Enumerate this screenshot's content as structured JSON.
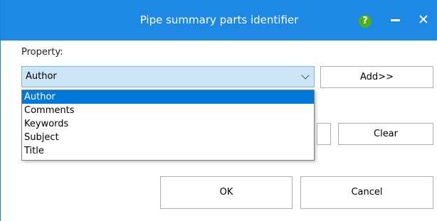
{
  "window": {
    "title": "Pipe summary parts identifier",
    "help_icon": "?",
    "close_icon": "✕"
  },
  "property": {
    "label": "Property:",
    "selected": "Author",
    "options": [
      "Author",
      "Comments",
      "Keywords",
      "Subject",
      "Title"
    ]
  },
  "buttons": {
    "add": "Add>>",
    "clear": "Clear",
    "ok": "OK",
    "cancel": "Cancel"
  },
  "colors": {
    "titlebar": "#1e88e5",
    "selection": "#0078d7",
    "combo_highlight": "#cde6f7",
    "help_green": "#4caf1c"
  }
}
